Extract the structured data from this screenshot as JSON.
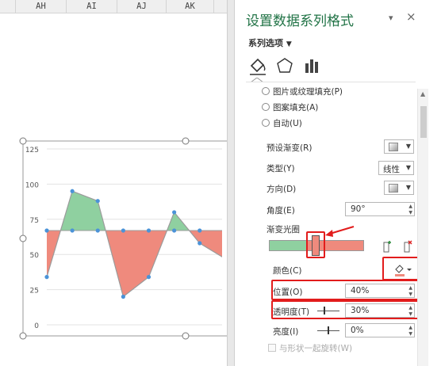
{
  "spreadsheet": {
    "columns": [
      "AH",
      "AI",
      "AJ",
      "AK"
    ]
  },
  "chart_data": {
    "type": "area",
    "x": [
      1,
      2,
      3,
      4,
      5,
      6,
      7,
      8,
      9
    ],
    "series": [
      {
        "values": [
          34,
          95,
          88,
          20,
          34,
          80,
          58,
          47,
          67
        ]
      }
    ],
    "baseline": 67,
    "yticks": [
      "125",
      "100",
      "75",
      "50",
      "25",
      "0"
    ],
    "ylim": [
      0,
      125
    ],
    "grid": true,
    "colors": {
      "above": "#8fd0a0",
      "below": "#ef8a7d",
      "line": "#9b9b9b",
      "marker": "#4b93d8"
    }
  },
  "panel": {
    "title": "设置数据系列格式",
    "close": "×",
    "pin": "▾",
    "series_options": "系列选项",
    "fill_options": [
      "图片或纹理填充(P)",
      "图案填充(A)",
      "自动(U)"
    ],
    "preset_gradient_label": "预设渐变(R)",
    "type_label": "类型(Y)",
    "type_value": "线性",
    "direction_label": "方向(D)",
    "angle_label": "角度(E)",
    "angle_value": "90°",
    "gradient_stops_label": "渐变光圈",
    "color_label": "颜色(C)",
    "position_label": "位置(O)",
    "position_value": "40%",
    "transparency_label": "透明度(T)",
    "transparency_value": "30%",
    "brightness_label": "亮度(I)",
    "brightness_value": "0%",
    "rotate_with_shape": "与形状一起旋转(W)"
  }
}
